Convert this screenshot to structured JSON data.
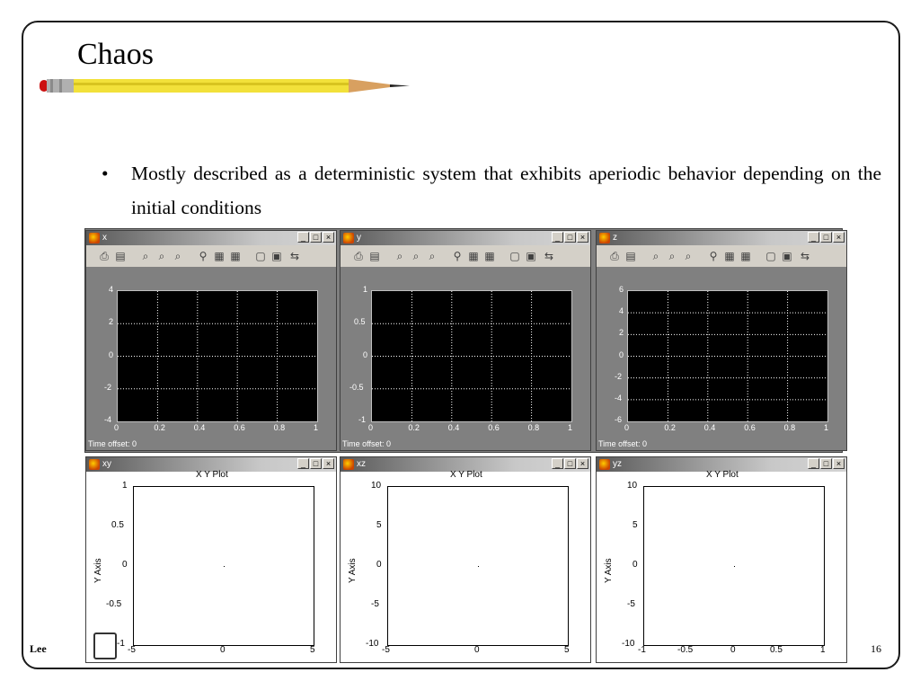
{
  "slide": {
    "title": "Chaos",
    "bullet": "Mostly described as a deterministic system that exhibits aperiodic behavior depending on the initial conditions",
    "footer_left": "Lee",
    "page_number": "16"
  },
  "scopes": [
    {
      "name": "x",
      "yticks": [
        "4",
        "2",
        "0",
        "-2",
        "-4"
      ],
      "xticks": [
        "0",
        "0.2",
        "0.4",
        "0.6",
        "0.8",
        "1"
      ],
      "time_offset": "Time offset:  0"
    },
    {
      "name": "y",
      "yticks": [
        "1",
        "0.5",
        "0",
        "-0.5",
        "-1"
      ],
      "xticks": [
        "0",
        "0.2",
        "0.4",
        "0.6",
        "0.8",
        "1"
      ],
      "time_offset": "Time offset:  0"
    },
    {
      "name": "z",
      "yticks": [
        "6",
        "4",
        "2",
        "0",
        "-2",
        "-4",
        "-6"
      ],
      "xticks": [
        "0",
        "0.2",
        "0.4",
        "0.6",
        "0.8",
        "1"
      ],
      "time_offset": "Time offset:  0"
    }
  ],
  "xyplots": [
    {
      "name": "xy",
      "title": "X Y Plot",
      "ylabel": "Y Axis",
      "yticks": [
        "1",
        "0.5",
        "0",
        "-0.5",
        "-1"
      ],
      "xticks": [
        "-5",
        "0",
        "5"
      ]
    },
    {
      "name": "xz",
      "title": "X Y Plot",
      "ylabel": "Y Axis",
      "yticks": [
        "10",
        "5",
        "0",
        "-5",
        "-10"
      ],
      "xticks": [
        "-5",
        "0",
        "5"
      ]
    },
    {
      "name": "yz",
      "title": "X Y Plot",
      "ylabel": "Y Axis",
      "yticks": [
        "10",
        "5",
        "0",
        "-5",
        "-10"
      ],
      "xticks": [
        "-1",
        "-0.5",
        "0",
        "0.5",
        "1"
      ]
    }
  ],
  "toolbar_icons": [
    "print-icon",
    "parameters-icon",
    "zoom-icon",
    "zoom-x-icon",
    "zoom-y-icon",
    "autoscale-icon",
    "save-axes-icon",
    "restore-axes-icon",
    "floating-scope-icon",
    "lock-axes-icon",
    "signal-selection-icon"
  ],
  "colors": {
    "scope_bg": "#808080",
    "plot_bg": "#000000",
    "grid": "#ffffff",
    "pencil": "#f2e13a"
  }
}
